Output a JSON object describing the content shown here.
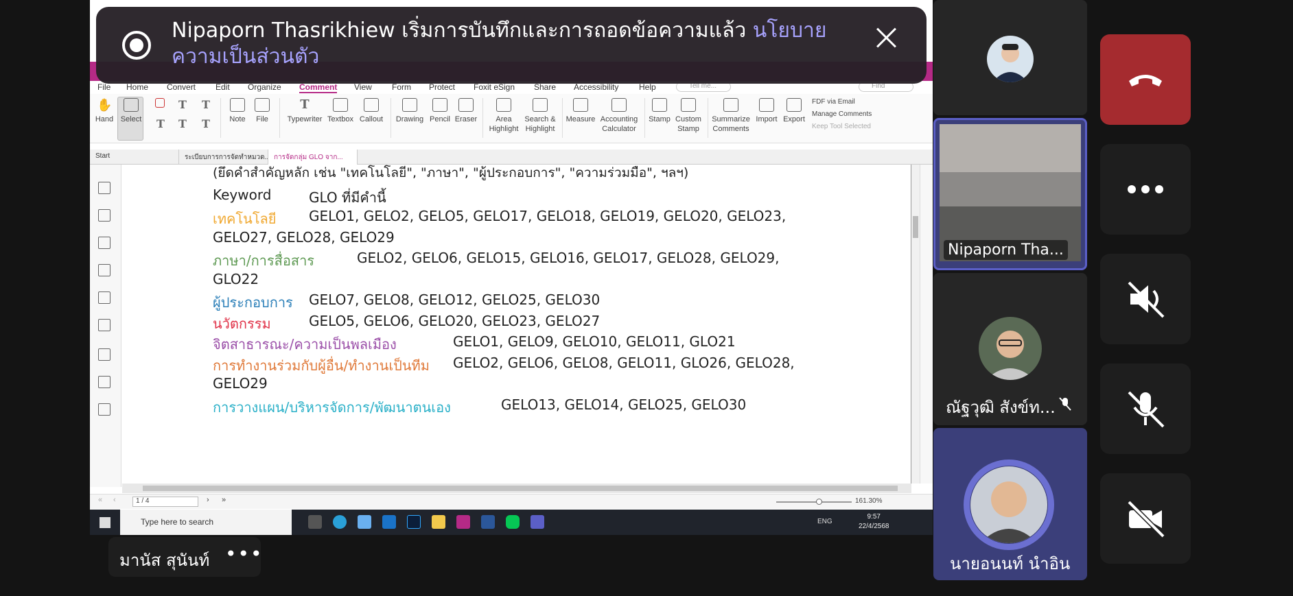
{
  "toast": {
    "message": "Nipaporn Thasrikhiew เริ่มการบันทึกและการถอดข้อความแล้ว",
    "link": "นโยบายความเป็นส่วนตัว"
  },
  "menu": [
    "File",
    "Home",
    "Convert",
    "Edit",
    "Organize",
    "Comment",
    "View",
    "Form",
    "Protect",
    "Foxit eSign",
    "Share",
    "Accessibility",
    "Help"
  ],
  "menu_tellme": "Tell me...",
  "menu_find": "Find",
  "ribbon": {
    "hand": "Hand",
    "select": "Select",
    "note": "Note",
    "file": "File",
    "typewriter": "Typewriter",
    "textbox": "Textbox",
    "callout": "Callout",
    "drawing": "Drawing",
    "pencil": "Pencil",
    "eraser": "Eraser",
    "area_highlight": [
      "Area",
      "Highlight"
    ],
    "search_highlight": [
      "Search &",
      "Highlight"
    ],
    "measure": "Measure",
    "accounting": [
      "Accounting",
      "Calculator"
    ],
    "stamp": "Stamp",
    "custom_stamp": [
      "Custom",
      "Stamp"
    ],
    "summarize": [
      "Summarize",
      "Comments"
    ],
    "import": "Import",
    "export": "Export",
    "fdf_email": "FDF via Email",
    "manage_comments": "Manage Comments",
    "keep_tool": "Keep Tool Selected"
  },
  "tabs": [
    "Start",
    "ระเบียบการการจัดทำหมวด...",
    "การจัดกลุ่ม GLO จาก..."
  ],
  "doc": {
    "top_line": "(ยึดคำสำคัญหลัก เช่น \"เทคโนโลยี\", \"ภาษา\", \"ผู้ประกอบการ\", \"ความร่วมมือ\", ฯลฯ)",
    "header_keyword": "Keyword",
    "header_glo": "GLO ที่มีคำนี้",
    "rows": [
      {
        "keyword": "เทคโนโลยี",
        "color": "#f0a830",
        "values": "GELO1, GELO2, GELO5, GELO17, GELO18, GELO19, GELO20, GELO23,",
        "cont": "GELO27, GELO28, GELO29"
      },
      {
        "keyword": "ภาษา/การสื่อสาร",
        "color": "#5f9a54",
        "values": "GELO2, GELO6, GELO15, GELO16, GELO17, GELO28, GELO29,",
        "cont": "GLO22"
      },
      {
        "keyword": "ผู้ประกอบการ",
        "color": "#2b7fb8",
        "values": "GELO7, GELO8, GELO12, GELO25, GELO30",
        "cont": ""
      },
      {
        "keyword": "นวัตกรรม",
        "color": "#e0344a",
        "values": "GELO5, GELO6, GELO20, GELO23, GELO27",
        "cont": ""
      },
      {
        "keyword": "จิตสาธารณะ/ความเป็นพลเมือง",
        "color": "#9b4fa8",
        "values": "GELO1, GELO9, GELO10, GELO11, GLO21",
        "cont": ""
      },
      {
        "keyword": "การทำงานร่วมกับผู้อื่น/ทำงานเป็นทีม",
        "color": "#e07a3a",
        "values": "GELO2, GELO6, GELO8, GELO11, GLO26, GELO28,",
        "cont": "GELO29"
      },
      {
        "keyword": "การวางแผน/บริหารจัดการ/พัฒนาตนเอง",
        "color": "#2ab0c8",
        "values": "GELO13, GELO14, GELO25, GELO30",
        "cont": ""
      }
    ]
  },
  "status": {
    "page": "1 / 4",
    "zoom": "161.30%"
  },
  "taskbar": {
    "search": "Type here to search",
    "time": "9:57",
    "date": "22/4/2568",
    "lang": "ENG"
  },
  "presenter": {
    "name": "มานัส สุนันท์",
    "more": "•••"
  },
  "participants": [
    {
      "name": ""
    },
    {
      "name": "Nipaporn Tha..."
    },
    {
      "name": "ณัฐวุฒิ สังข์ท..."
    },
    {
      "name": "นายอนนท์ นำอิน"
    }
  ],
  "colors": {
    "accent": "#b52a86",
    "end_call": "#a52b2f",
    "tile_selected": "#3b3f7a",
    "link": "#a8a3ff"
  }
}
